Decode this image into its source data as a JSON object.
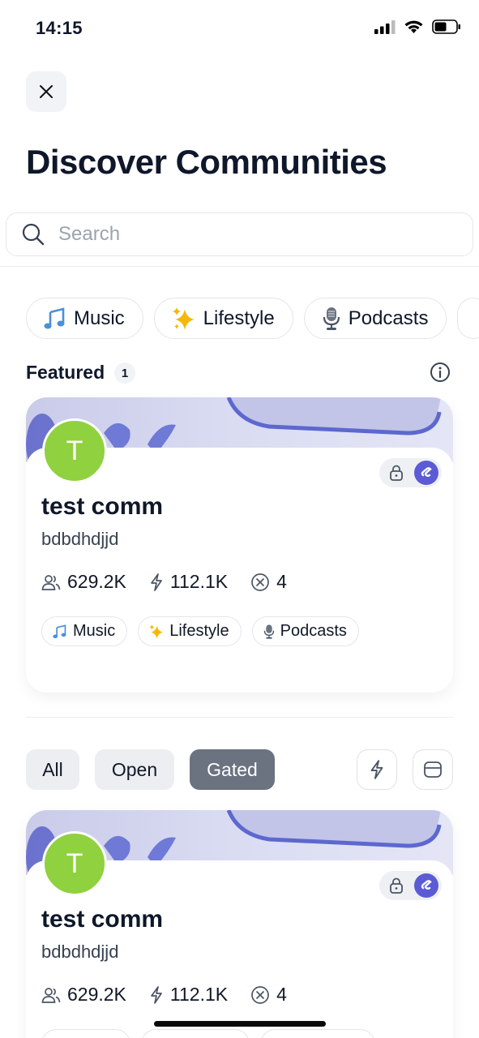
{
  "status_bar": {
    "time": "14:15"
  },
  "header": {
    "title": "Discover Communities"
  },
  "search": {
    "placeholder": "Search"
  },
  "categories": [
    {
      "emoji": "music-notes-icon",
      "label": "Music"
    },
    {
      "emoji": "sparkles-icon",
      "label": "Lifestyle"
    },
    {
      "emoji": "microphone-icon",
      "label": "Podcasts"
    }
  ],
  "featured": {
    "label": "Featured",
    "count": "1"
  },
  "featured_card": {
    "avatar_letter": "T",
    "name": "test comm",
    "description": "bdbdhdjjd",
    "members": "629.2K",
    "energy": "112.1K",
    "posts": "4",
    "tags": [
      "Music",
      "Lifestyle",
      "Podcasts"
    ],
    "accent_color": "#5b5bd6",
    "avatar_color": "#8fd13f"
  },
  "filters": {
    "options": [
      "All",
      "Open",
      "Gated"
    ],
    "selected": "Gated"
  },
  "list_card": {
    "avatar_letter": "T",
    "name": "test comm",
    "description": "bdbdhdjjd",
    "members": "629.2K",
    "energy": "112.1K",
    "posts": "4"
  }
}
